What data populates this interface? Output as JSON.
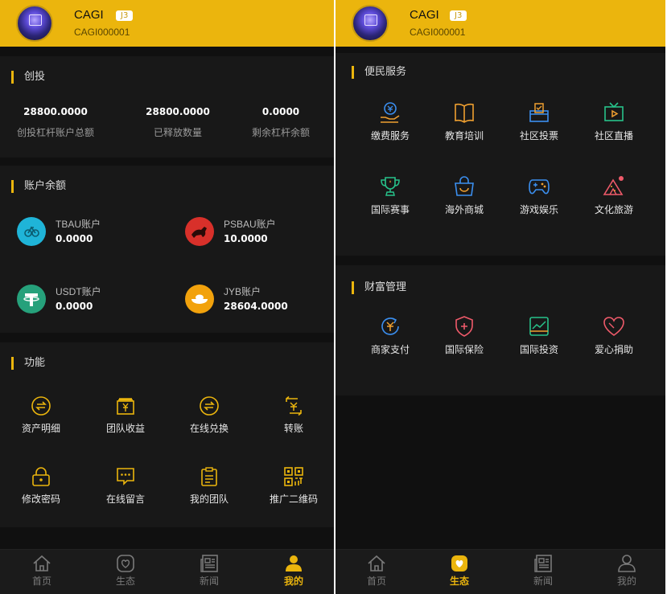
{
  "left": {
    "user": {
      "name": "CAGI",
      "level": "J3",
      "id": "CAGI000001"
    },
    "invest": {
      "title": "创投",
      "stats": [
        {
          "value": "28800.0000",
          "label": "创投杠杆账户总额"
        },
        {
          "value": "28800.0000",
          "label": "已释放数量"
        },
        {
          "value": "0.0000",
          "label": "剩余杠杆余额"
        }
      ]
    },
    "balance": {
      "title": "账户余额",
      "accounts": [
        {
          "name": "TBAU账户",
          "value": "0.0000"
        },
        {
          "name": "PSBAU账户",
          "value": "10.0000"
        },
        {
          "name": "USDT账户",
          "value": "0.0000"
        },
        {
          "name": "JYB账户",
          "value": "28604.0000"
        }
      ]
    },
    "functions": {
      "title": "功能",
      "items": [
        {
          "label": "资产明细",
          "icon": "exchange-circle-icon"
        },
        {
          "label": "团队收益",
          "icon": "yuan-box-icon"
        },
        {
          "label": "在线兑换",
          "icon": "exchange-circle-icon"
        },
        {
          "label": "转账",
          "icon": "transfer-yuan-icon"
        },
        {
          "label": "修改密码",
          "icon": "lock-icon"
        },
        {
          "label": "在线留言",
          "icon": "message-icon"
        },
        {
          "label": "我的团队",
          "icon": "clipboard-icon"
        },
        {
          "label": "推广二维码",
          "icon": "qrcode-icon"
        }
      ]
    },
    "tabs": [
      {
        "label": "首页",
        "icon": "home-icon"
      },
      {
        "label": "生态",
        "icon": "heart-icon"
      },
      {
        "label": "新闻",
        "icon": "news-icon"
      },
      {
        "label": "我的",
        "icon": "user-icon"
      }
    ]
  },
  "right": {
    "user": {
      "name": "CAGI",
      "level": "J3",
      "id": "CAGI000001"
    },
    "services": {
      "title": "便民服务",
      "items": [
        {
          "label": "缴费服务",
          "icon": "payment-hand-icon"
        },
        {
          "label": "教育培训",
          "icon": "book-icon"
        },
        {
          "label": "社区投票",
          "icon": "ballot-box-icon"
        },
        {
          "label": "社区直播",
          "icon": "tv-play-icon"
        },
        {
          "label": "国际赛事",
          "icon": "trophy-icon"
        },
        {
          "label": "海外商城",
          "icon": "shopping-bag-icon"
        },
        {
          "label": "游戏娱乐",
          "icon": "gamepad-icon"
        },
        {
          "label": "文化旅游",
          "icon": "tent-icon"
        }
      ]
    },
    "wealth": {
      "title": "财富管理",
      "items": [
        {
          "label": "商家支付",
          "icon": "yuan-refresh-icon"
        },
        {
          "label": "国际保险",
          "icon": "shield-plus-icon"
        },
        {
          "label": "国际投资",
          "icon": "chart-card-icon"
        },
        {
          "label": "爱心捐助",
          "icon": "heart-outline-icon"
        }
      ]
    },
    "tabs": [
      {
        "label": "首页",
        "icon": "home-icon"
      },
      {
        "label": "生态",
        "icon": "heart-icon"
      },
      {
        "label": "新闻",
        "icon": "news-icon"
      },
      {
        "label": "我的",
        "icon": "user-icon"
      }
    ]
  },
  "colors": {
    "accent": "#ebb50d",
    "background": "#101010",
    "card": "#181818",
    "blue_icon": "#3b8ff0",
    "orange_icon": "#f0a030",
    "green_icon": "#27c28a",
    "red_icon": "#ef5a6a"
  }
}
